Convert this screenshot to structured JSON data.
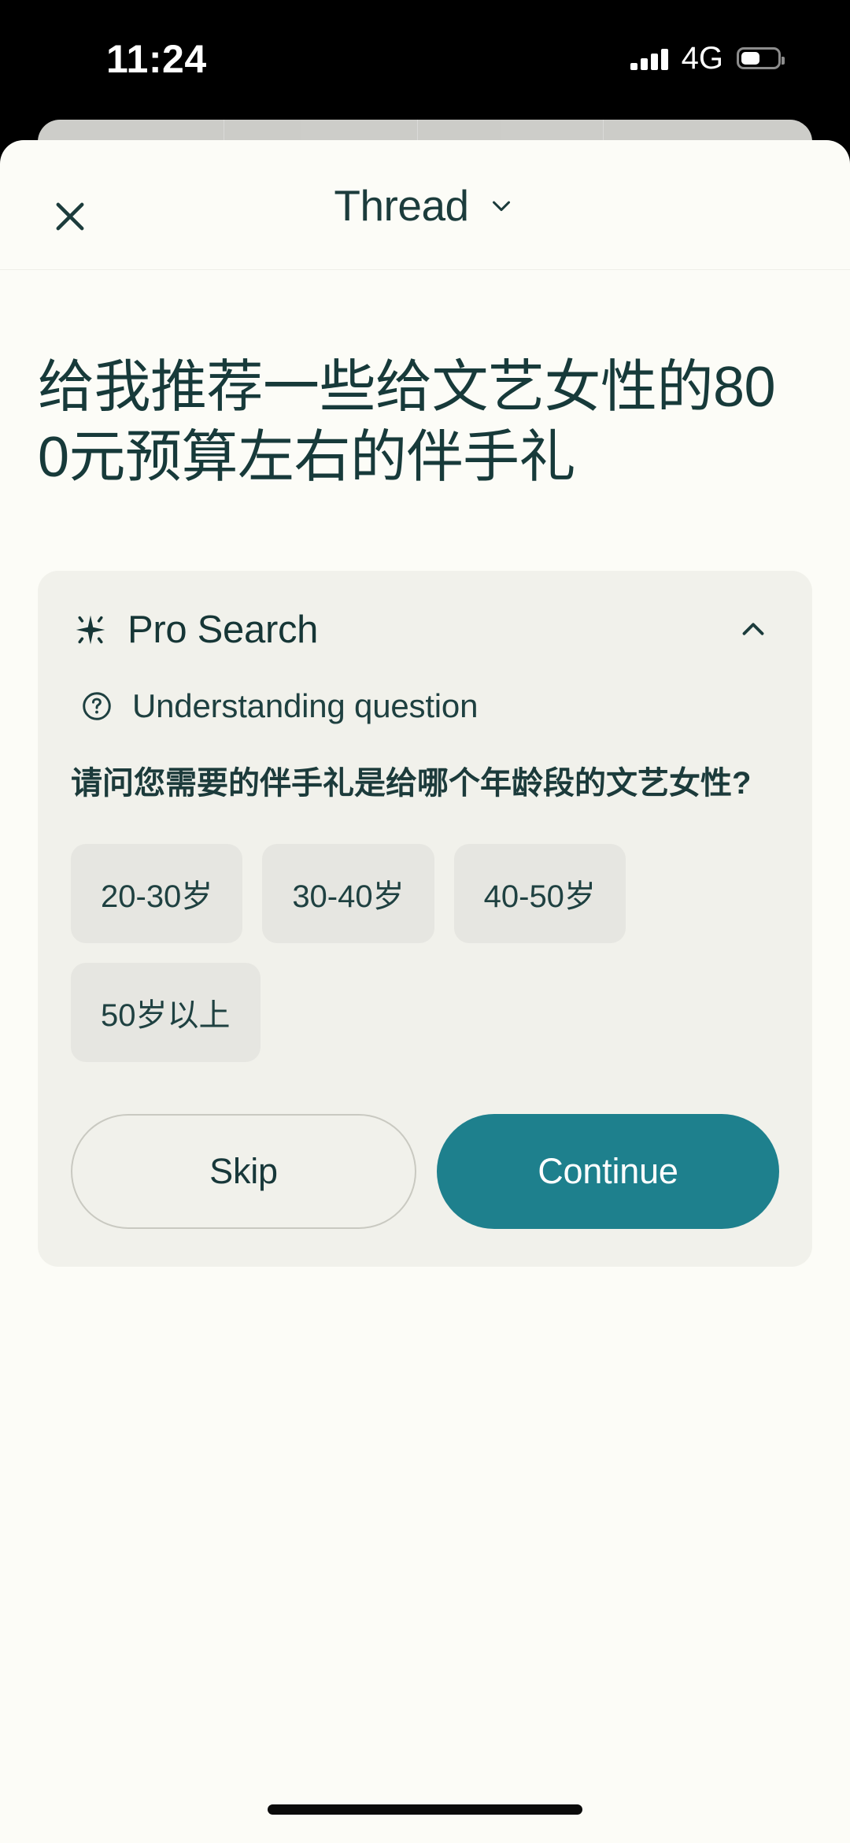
{
  "status_bar": {
    "time": "11:24",
    "network_label": "4G",
    "signal_icon": "signal-bars-icon",
    "battery_icon": "battery-icon",
    "battery_level_percent": 52
  },
  "header": {
    "close_icon": "close-icon",
    "title": "Thread",
    "chevron_icon": "chevron-down-icon"
  },
  "thread": {
    "question_title": "给我推荐一些给文艺女性的800元预算左右的伴手礼"
  },
  "pro_search": {
    "sparkle_icon": "sparkle-icon",
    "label": "Pro Search",
    "collapse_icon": "chevron-up-icon",
    "step": {
      "icon": "question-circle-icon",
      "label": "Understanding question"
    },
    "followup_question": "请问您需要的伴手礼是给哪个年龄段的文艺女性?",
    "options": [
      {
        "label": "20-30岁"
      },
      {
        "label": "30-40岁"
      },
      {
        "label": "40-50岁"
      },
      {
        "label": "50岁以上"
      }
    ],
    "skip_label": "Skip",
    "continue_label": "Continue"
  },
  "colors": {
    "accent_teal": "#1E808D",
    "text_dark": "#173A3A",
    "card_background": "#F1F1EB",
    "chip_background": "#E6E6E1",
    "page_background": "#FCFCF7"
  },
  "system": {
    "home_indicator": "home-indicator"
  }
}
